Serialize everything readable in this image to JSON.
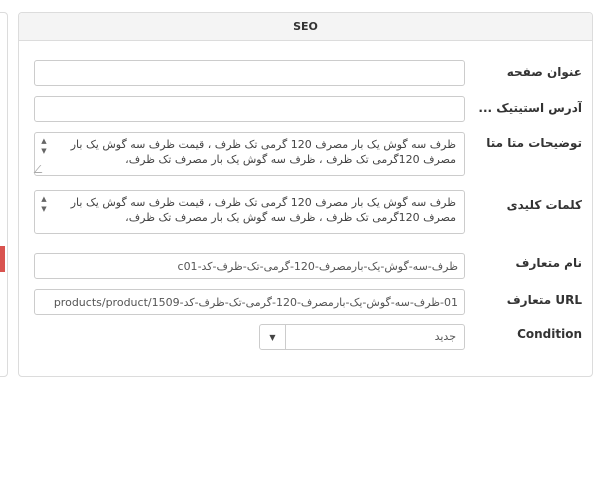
{
  "panel": {
    "title": "SEO"
  },
  "fields": {
    "page_title": {
      "label": "عنوان صفحه",
      "value": ""
    },
    "static_address": {
      "label": "آدرس استیتیک ...",
      "value": ""
    },
    "meta_description": {
      "label": "توضیحات متا متا",
      "value": "ظرف سه گوش یک بار مصرف 120 گرمی تک ظرف ، قیمت ظرف سه گوش یک بار مصرف 120گرمی تک ظرف ، ظرف سه گوش یک بار مصرف تک ظرف،"
    },
    "keywords": {
      "label": "کلمات کلیدی",
      "value": "ظرف سه گوش یک بار مصرف 120 گرمی تک ظرف ، قیمت ظرف سه گوش یک بار مصرف 120گرمی تک ظرف ، ظرف سه گوش یک بار مصرف تک ظرف،"
    },
    "canonical_name": {
      "label": "نام متعارف",
      "value": "ظرف-سه-گوش-یک-بارمصرف-120-گرمی-تک-ظرف-کد-c01"
    },
    "canonical_url": {
      "label": "URL متعارف",
      "value": "01-ظرف-سه-گوش-یک-بارمصرف-120-گرمی-تک-ظرف-کد-products/product/1509"
    },
    "condition": {
      "label": "Condition",
      "value": "جدید"
    }
  }
}
